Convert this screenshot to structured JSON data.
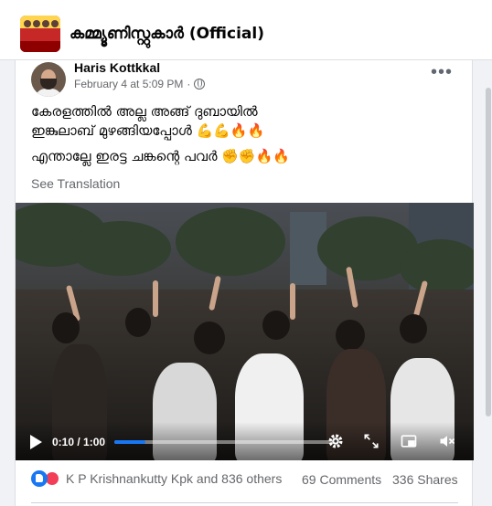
{
  "group": {
    "name": "കമ്മ്യൂണിസ്റ്റുകാർ (Official)"
  },
  "post": {
    "author": "Haris Kottkkal",
    "date": "February 4 at 5:09 PM",
    "separator": "·",
    "more_label": "•••",
    "lines": [
      "കേരളത്തിൽ അല്ല അങ്ങ് ദുബായിൽ",
      "ഇങ്കുലാബ് മുഴങ്ങിയപ്പോൾ 💪💪🔥🔥",
      "എന്താല്ലേ ഇരട്ട ചങ്കന്റെ പവർ ✊✊🔥🔥"
    ],
    "see_translation": "See Translation"
  },
  "video": {
    "time": "0:10 / 1:00",
    "progress_fraction": 0.14,
    "icons": [
      "play-icon",
      "settings-icon",
      "fullscreen-icon",
      "picture-in-picture-icon",
      "volume-muted-icon"
    ]
  },
  "engagement": {
    "reactions_text": "K P Krishnankutty Kpk and 836 others",
    "comments": "69 Comments",
    "shares": "336 Shares"
  },
  "colors": {
    "accent": "#1877f2",
    "love": "#f33e58",
    "secondary_text": "#65676b"
  }
}
